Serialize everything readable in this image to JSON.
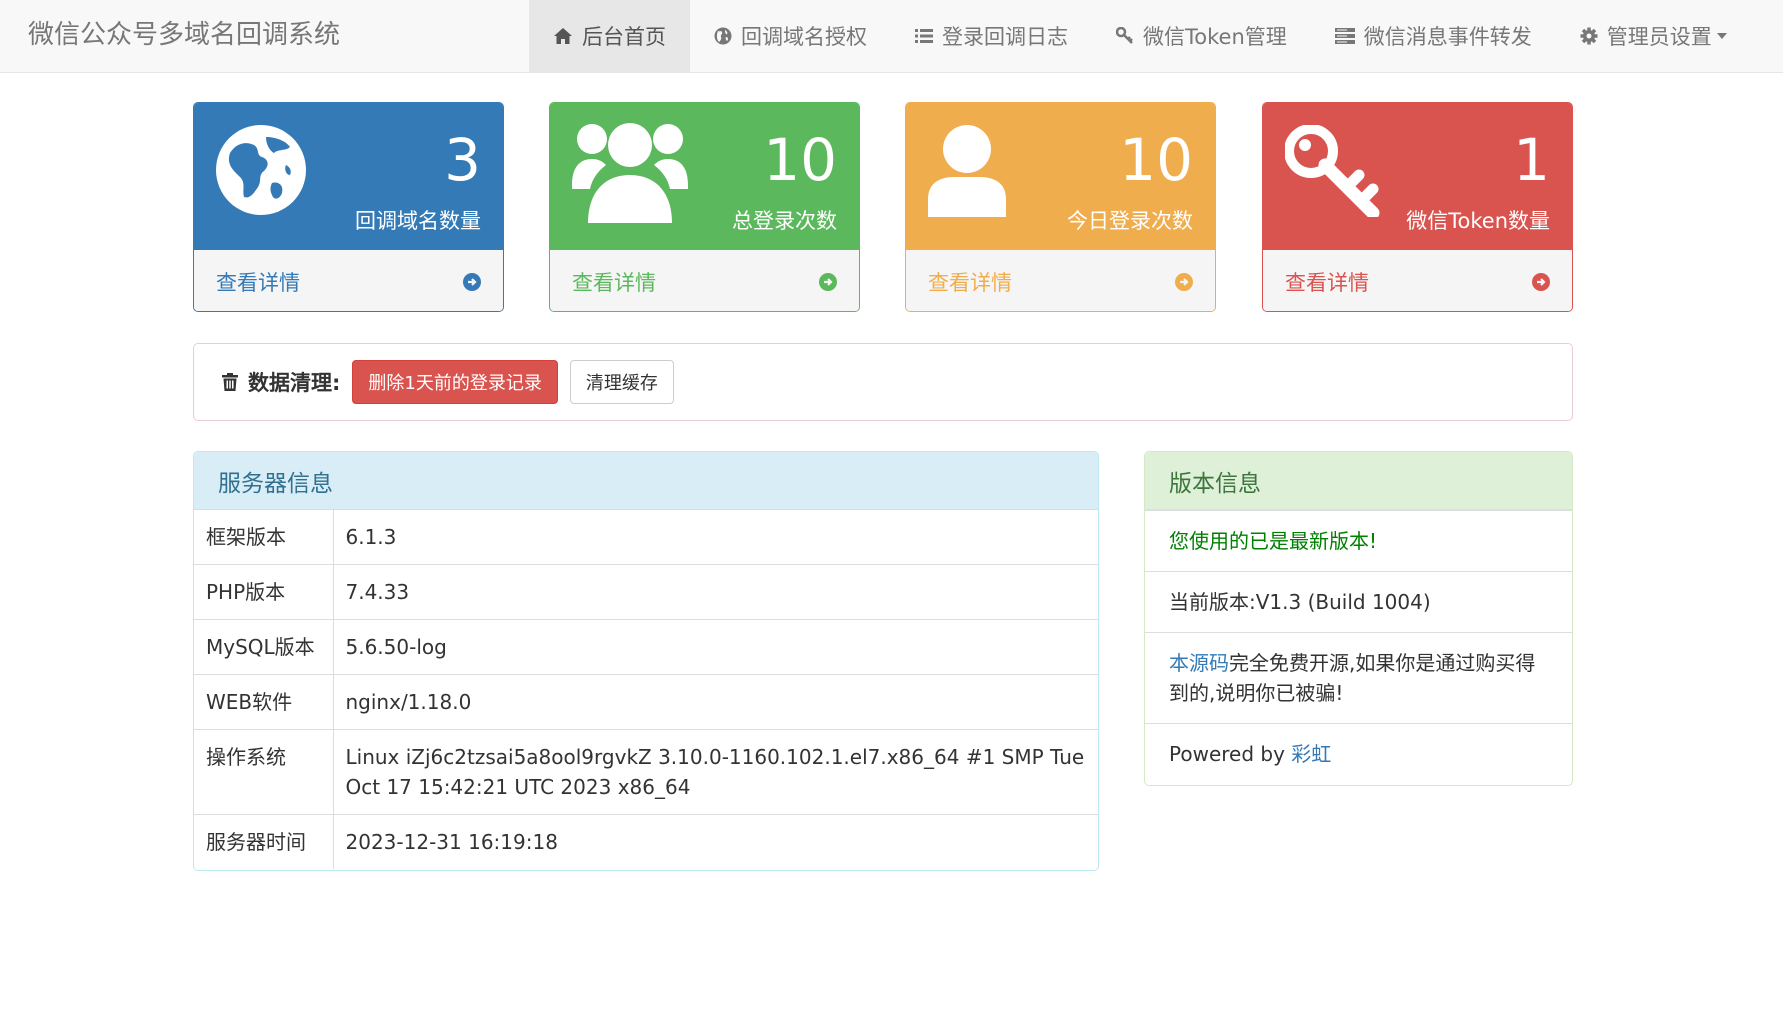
{
  "navbar": {
    "brand": "微信公众号多域名回调系统",
    "items": [
      {
        "label": "后台首页",
        "icon": "home-icon",
        "active": true
      },
      {
        "label": "回调域名授权",
        "icon": "globe-icon"
      },
      {
        "label": "登录回调日志",
        "icon": "list-icon"
      },
      {
        "label": "微信Token管理",
        "icon": "key-icon"
      },
      {
        "label": "微信消息事件转发",
        "icon": "server-icon"
      },
      {
        "label": "管理员设置",
        "icon": "gear-icon",
        "dropdown": true
      }
    ]
  },
  "stats": [
    {
      "count": "3",
      "label": "回调域名数量",
      "link": "查看详情",
      "icon": "globe-icon",
      "color": "#337ab7"
    },
    {
      "count": "10",
      "label": "总登录次数",
      "link": "查看详情",
      "icon": "users-icon",
      "color": "#5cb85c"
    },
    {
      "count": "10",
      "label": "今日登录次数",
      "link": "查看详情",
      "icon": "user-icon",
      "color": "#f0ad4e"
    },
    {
      "count": "1",
      "label": "微信Token数量",
      "link": "查看详情",
      "icon": "key-icon",
      "color": "#d9534f"
    }
  ],
  "cleanup": {
    "title": "数据清理:",
    "delete_button": "删除1天前的登录记录",
    "clear_cache_button": "清理缓存"
  },
  "server": {
    "title": "服务器信息",
    "rows": [
      {
        "key": "框架版本",
        "value": "6.1.3"
      },
      {
        "key": "PHP版本",
        "value": "7.4.33"
      },
      {
        "key": "MySQL版本",
        "value": "5.6.50-log"
      },
      {
        "key": "WEB软件",
        "value": "nginx/1.18.0"
      },
      {
        "key": "操作系统",
        "value": "Linux iZj6c2tzsai5a8ool9rgvkZ 3.10.0-1160.102.1.el7.x86_64 #1 SMP Tue Oct 17 15:42:21 UTC 2023 x86_64"
      },
      {
        "key": "服务器时间",
        "value": "2023-12-31 16:19:18"
      }
    ]
  },
  "version": {
    "title": "版本信息",
    "status": "您使用的已是最新版本!",
    "current": "当前版本:V1.3 (Build 1004)",
    "source_link": "本源码",
    "source_text": "完全免费开源,如果你是通过购买得到的,说明你已被骗!",
    "powered_by": "Powered by ",
    "powered_link": "彩虹"
  },
  "colors": {
    "primary": "#337ab7",
    "success": "#5cb85c",
    "warning": "#f0ad4e",
    "danger": "#d9534f"
  }
}
